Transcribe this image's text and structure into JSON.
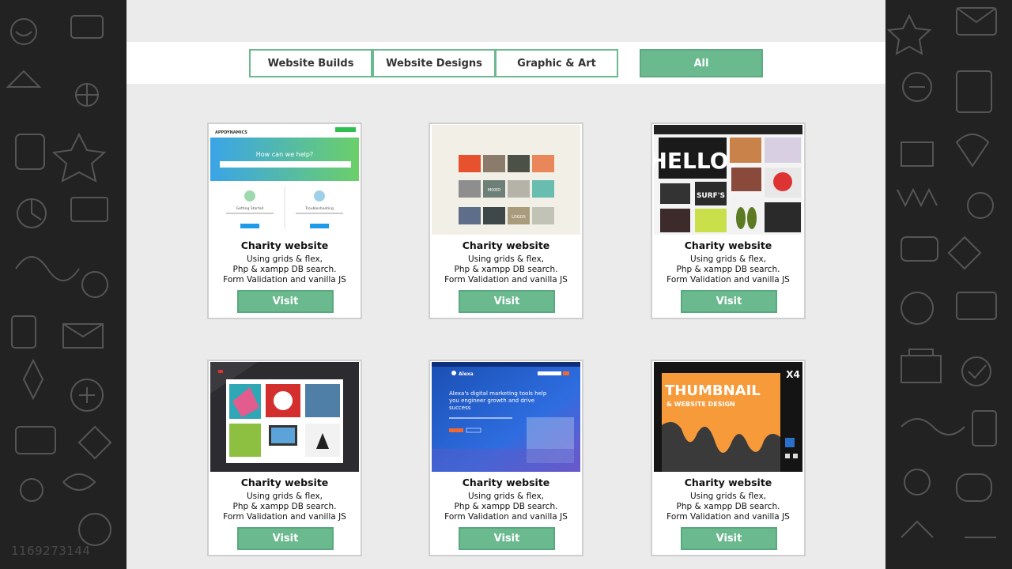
{
  "filters": {
    "website_builds": "Website Builds",
    "website_designs": "Website Designs",
    "graphic_art": "Graphic & Art",
    "all": "All",
    "active": "All"
  },
  "watermark": "1169273144",
  "colors": {
    "accent": "#6bb98f",
    "page_background": "#ebebeb",
    "doodle_background": "#222222"
  },
  "thumbnails": {
    "help_center": {
      "brand": "APPDYNAMICS",
      "headline": "How can we help?",
      "left_col": "Getting Started",
      "right_col": "Troubleshooting"
    },
    "grid_gallery": {
      "tile_label": "MIXED",
      "tile_label2": "LOGOS"
    },
    "hello_collage": {
      "headline": "HELLO.",
      "sub": "SURF'S"
    },
    "alexa": {
      "brand": "Alexa",
      "headline": "Alexa's digital marketing tools help you engineer growth and drive success"
    },
    "thumbnail_design": {
      "headline": "THUMBNAIL",
      "sub": "& WEBSITE DESIGN",
      "badge": "X4"
    }
  },
  "cards": [
    {
      "title": "Charity website",
      "desc": [
        "Using grids & flex,",
        "Php & xampp DB search.",
        "Form Validation and vanilla JS"
      ],
      "button": "Visit",
      "thumbnail": "help-center-screenshot"
    },
    {
      "title": "Charity website",
      "desc": [
        "Using grids & flex,",
        "Php & xampp DB search.",
        "Form Validation and vanilla JS"
      ],
      "button": "Visit",
      "thumbnail": "grid-gallery-screenshot"
    },
    {
      "title": "Charity website",
      "desc": [
        "Using grids & flex,",
        "Php & xampp DB search.",
        "Form Validation and vanilla JS"
      ],
      "button": "Visit",
      "thumbnail": "hello-collage-screenshot"
    },
    {
      "title": "Charity website",
      "desc": [
        "Using grids & flex,",
        "Php & xampp DB search.",
        "Form Validation and vanilla JS"
      ],
      "button": "Visit",
      "thumbnail": "portfolio-grid-screenshot"
    },
    {
      "title": "Charity website",
      "desc": [
        "Using grids & flex,",
        "Php & xampp DB search.",
        "Form Validation and vanilla JS"
      ],
      "button": "Visit",
      "thumbnail": "alexa-landing-screenshot"
    },
    {
      "title": "Charity website",
      "desc": [
        "Using grids & flex,",
        "Php & xampp DB search.",
        "Form Validation and vanilla JS"
      ],
      "button": "Visit",
      "thumbnail": "thumbnail-design-screenshot"
    }
  ]
}
